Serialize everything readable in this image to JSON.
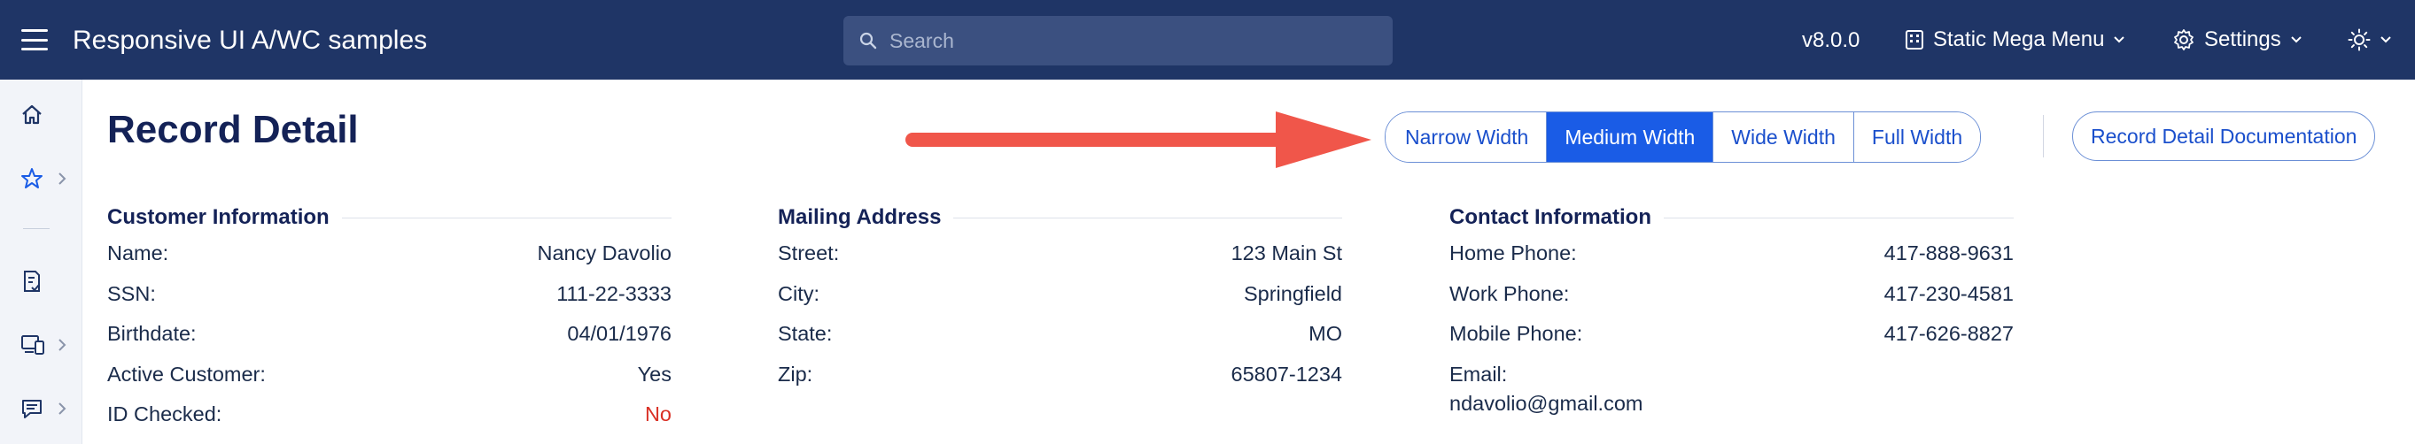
{
  "header": {
    "app_title": "Responsive UI A/WC samples",
    "search_placeholder": "Search",
    "version": "v8.0.0",
    "mega_menu_label": "Static Mega Menu",
    "settings_label": "Settings",
    "theme_icon": "sun-icon"
  },
  "sidebar": {
    "items": [
      {
        "icon": "home-icon"
      },
      {
        "icon": "star-icon"
      },
      {
        "icon": "document-check-icon"
      },
      {
        "icon": "devices-icon"
      },
      {
        "icon": "chat-icon"
      }
    ]
  },
  "page": {
    "title": "Record Detail",
    "width_buttons": [
      "Narrow Width",
      "Medium Width",
      "Wide Width",
      "Full Width"
    ],
    "active_width": "Medium Width",
    "doc_button": "Record Detail Documentation"
  },
  "customer": {
    "heading": "Customer Information",
    "rows": [
      {
        "label": "Name:",
        "value": "Nancy Davolio"
      },
      {
        "label": "SSN:",
        "value": "111-22-3333"
      },
      {
        "label": "Birthdate:",
        "value": "04/01/1976"
      },
      {
        "label": "Active Customer:",
        "value": "Yes"
      },
      {
        "label": "ID Checked:",
        "value": "No"
      }
    ]
  },
  "mailing": {
    "heading": "Mailing Address",
    "rows": [
      {
        "label": "Street:",
        "value": "123 Main St"
      },
      {
        "label": "City:",
        "value": "Springfield"
      },
      {
        "label": "State:",
        "value": "MO"
      },
      {
        "label": "Zip:",
        "value": "65807-1234"
      }
    ]
  },
  "contact": {
    "heading": "Contact Information",
    "rows": [
      {
        "label": "Home Phone:",
        "value": "417-888-9631"
      },
      {
        "label": "Work Phone:",
        "value": "417-230-4581"
      },
      {
        "label": "Mobile Phone:",
        "value": "417-626-8827"
      }
    ],
    "email_label": "Email:",
    "email_value": "ndavolio@gmail.com"
  },
  "colors": {
    "header_bg": "#1f3566",
    "accent": "#1a5ce6",
    "arrow": "#f0564a",
    "negative": "#d93025"
  }
}
